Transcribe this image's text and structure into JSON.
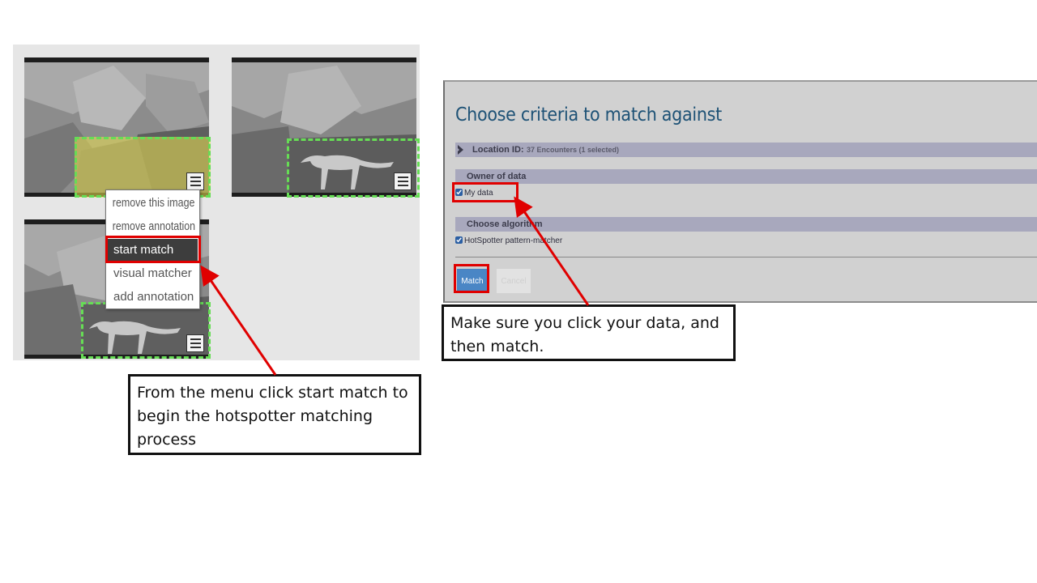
{
  "gallery": {
    "context_menu": {
      "items": [
        {
          "label": "remove this image",
          "active": false
        },
        {
          "label": "remove annotation",
          "active": false
        },
        {
          "label": "start match",
          "active": true
        },
        {
          "label": "visual matcher",
          "active": false
        },
        {
          "label": "add annotation",
          "active": false
        }
      ]
    },
    "icons": {
      "annotation_menu": "hamburger-menu-icon"
    }
  },
  "dialog": {
    "title": "Choose criteria to match against",
    "location": {
      "label": "Location ID:",
      "note": "37 Encounters (1 selected)"
    },
    "owner_section": {
      "label": "Owner of data",
      "option": "My data",
      "checked": true
    },
    "algorithm_section": {
      "label": "Choose algorithm",
      "option": "HotSpotter pattern-matcher",
      "checked": true
    },
    "buttons": {
      "match": "Match",
      "cancel": "Cancel"
    }
  },
  "callouts": {
    "left": "From the menu click start match to begin the hotspotter matching process",
    "right": "Make sure you click your data, and then match."
  },
  "colors": {
    "highlight": "#e00000",
    "annotation_box": "#66dd55",
    "title": "#1e5276",
    "match_button": "#4a86c5"
  }
}
